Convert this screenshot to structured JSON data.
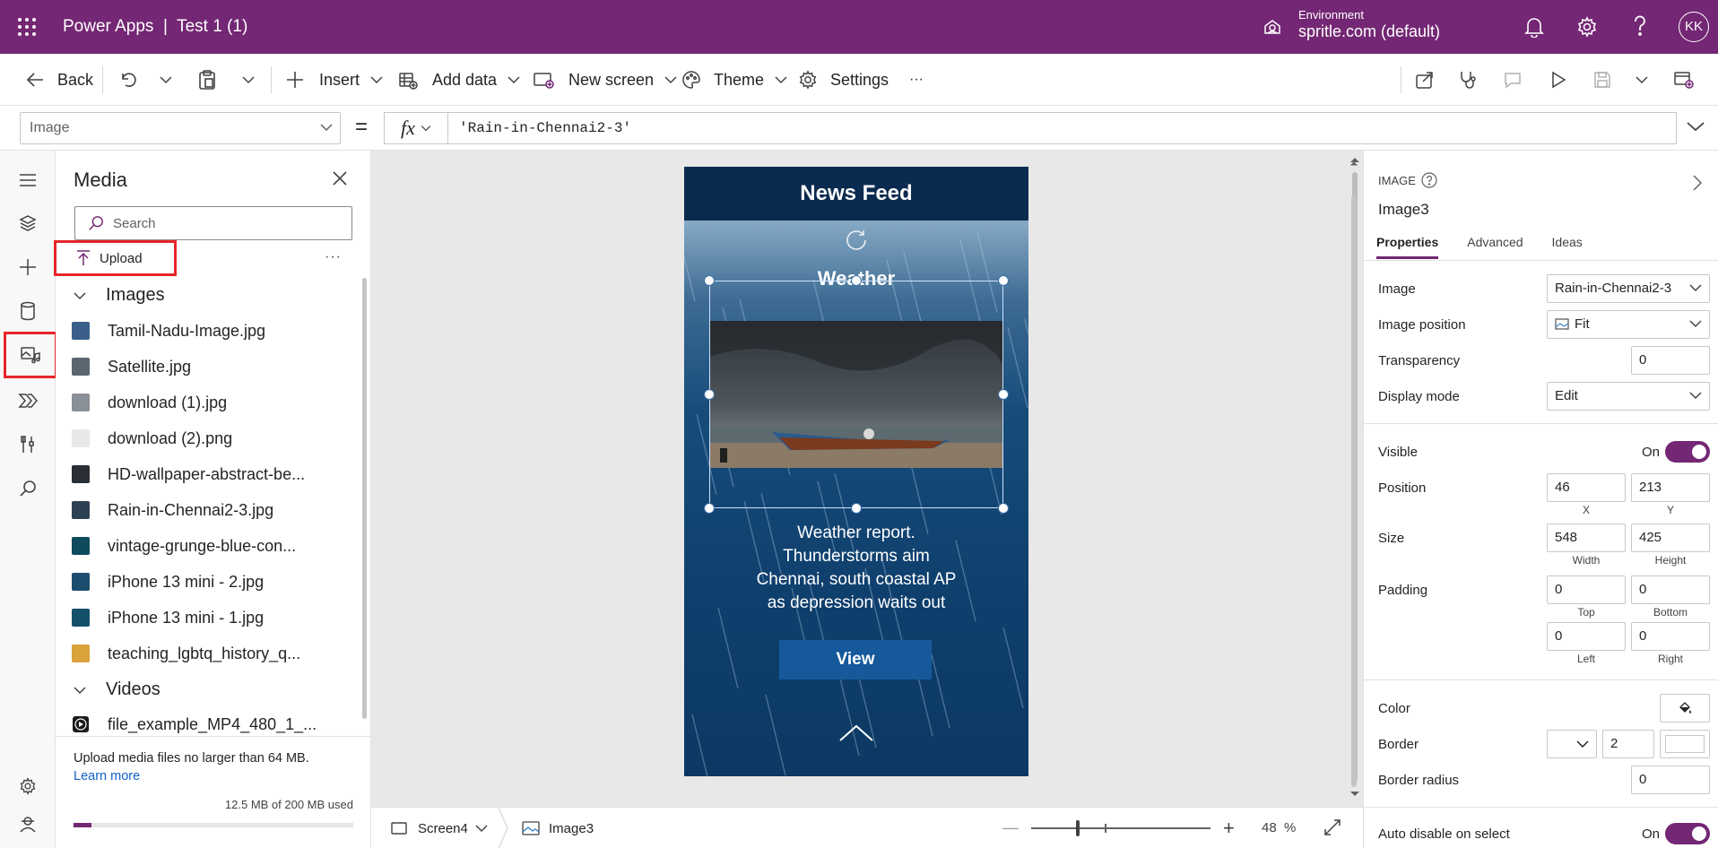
{
  "topbar": {
    "app_title": "Power Apps  |  Test 1 (1)",
    "environment_label": "Environment",
    "environment_value": "spritle.com (default)",
    "avatar_initials": "KK"
  },
  "cmdbar": {
    "back": "Back",
    "insert": "Insert",
    "add_data": "Add data",
    "new_screen": "New screen",
    "theme": "Theme",
    "settings": "Settings",
    "more": "···"
  },
  "formula": {
    "property": "Image",
    "equals": "=",
    "fx": "fx",
    "value": "'Rain-in-Chennai2-3'"
  },
  "media": {
    "title": "Media",
    "search_placeholder": "Search",
    "upload": "Upload",
    "more": "···",
    "images_section": "Images",
    "videos_section": "Videos",
    "images": [
      {
        "name": "Tamil-Nadu-Image.jpg",
        "color": "#3a5f8a"
      },
      {
        "name": "Satellite.jpg",
        "color": "#5a6670"
      },
      {
        "name": "download (1).jpg",
        "color": "#8a9097"
      },
      {
        "name": "download (2).png",
        "color": "#e8e8e8"
      },
      {
        "name": "HD-wallpaper-abstract-be...",
        "color": "#2a2f36"
      },
      {
        "name": "Rain-in-Chennai2-3.jpg",
        "color": "#2e4154"
      },
      {
        "name": "vintage-grunge-blue-con...",
        "color": "#0f4a5e"
      },
      {
        "name": "iPhone 13 mini - 2.jpg",
        "color": "#1d4d6e"
      },
      {
        "name": "iPhone 13 mini - 1.jpg",
        "color": "#14506a"
      },
      {
        "name": "teaching_lgbtq_history_q...",
        "color": "#d9a23a"
      }
    ],
    "videos": [
      {
        "name": "file_example_MP4_480_1_..."
      }
    ],
    "footer_note": "Upload media files no larger than 64 MB.",
    "learn_more": "Learn more",
    "usage": "12.5 MB of 200 MB used",
    "usage_fraction": 0.0625
  },
  "phone": {
    "header": "News Feed",
    "weather_title": "Weather",
    "report_lines": [
      "Weather report.",
      "Thunderstorms aim",
      "Chennai, south coastal AP",
      "as depression waits out"
    ],
    "view_button": "View"
  },
  "statusbar": {
    "screen": "Screen4",
    "control": "Image3",
    "zoom_minus": "—",
    "zoom_plus": "+",
    "zoom": "48",
    "zoom_unit": "%"
  },
  "props": {
    "type": "IMAGE",
    "name": "Image3",
    "tabs": [
      "Properties",
      "Advanced",
      "Ideas"
    ],
    "image_label": "Image",
    "image_value": "Rain-in-Chennai2-3",
    "image_position_label": "Image position",
    "image_position_value": "Fit",
    "transparency_label": "Transparency",
    "transparency_value": "0",
    "display_mode_label": "Display mode",
    "display_mode_value": "Edit",
    "visible_label": "Visible",
    "visible_value": "On",
    "position_label": "Position",
    "x": "46",
    "y": "213",
    "x_label": "X",
    "y_label": "Y",
    "size_label": "Size",
    "width": "548",
    "height": "425",
    "width_label": "Width",
    "height_label": "Height",
    "padding_label": "Padding",
    "pad_top": "0",
    "pad_bottom": "0",
    "pad_left": "0",
    "pad_right": "0",
    "top_label": "Top",
    "bottom_label": "Bottom",
    "left_label": "Left",
    "right_label": "Right",
    "color_label": "Color",
    "border_label": "Border",
    "border_value": "2",
    "border_radius_label": "Border radius",
    "border_radius_value": "0",
    "auto_disable_label": "Auto disable on select",
    "auto_disable_value": "On"
  }
}
